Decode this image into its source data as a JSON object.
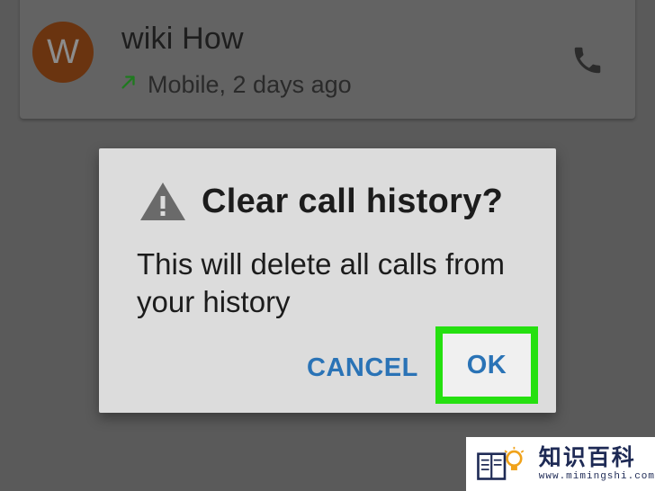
{
  "call_log": {
    "avatar_letter": "W",
    "contact_name": "wiki How",
    "call_detail": "Mobile, 2 days ago",
    "call_type_icon": "outgoing-arrow-icon",
    "action_icon": "phone-icon"
  },
  "dialog": {
    "title": "Clear call history?",
    "title_icon": "warning-icon",
    "message": "This will delete all calls from your history",
    "cancel_label": "CANCEL",
    "ok_label": "OK"
  },
  "colors": {
    "accent": "#2a73b6",
    "highlight": "#25e010",
    "outgoing_arrow": "#1f8a1f"
  }
}
